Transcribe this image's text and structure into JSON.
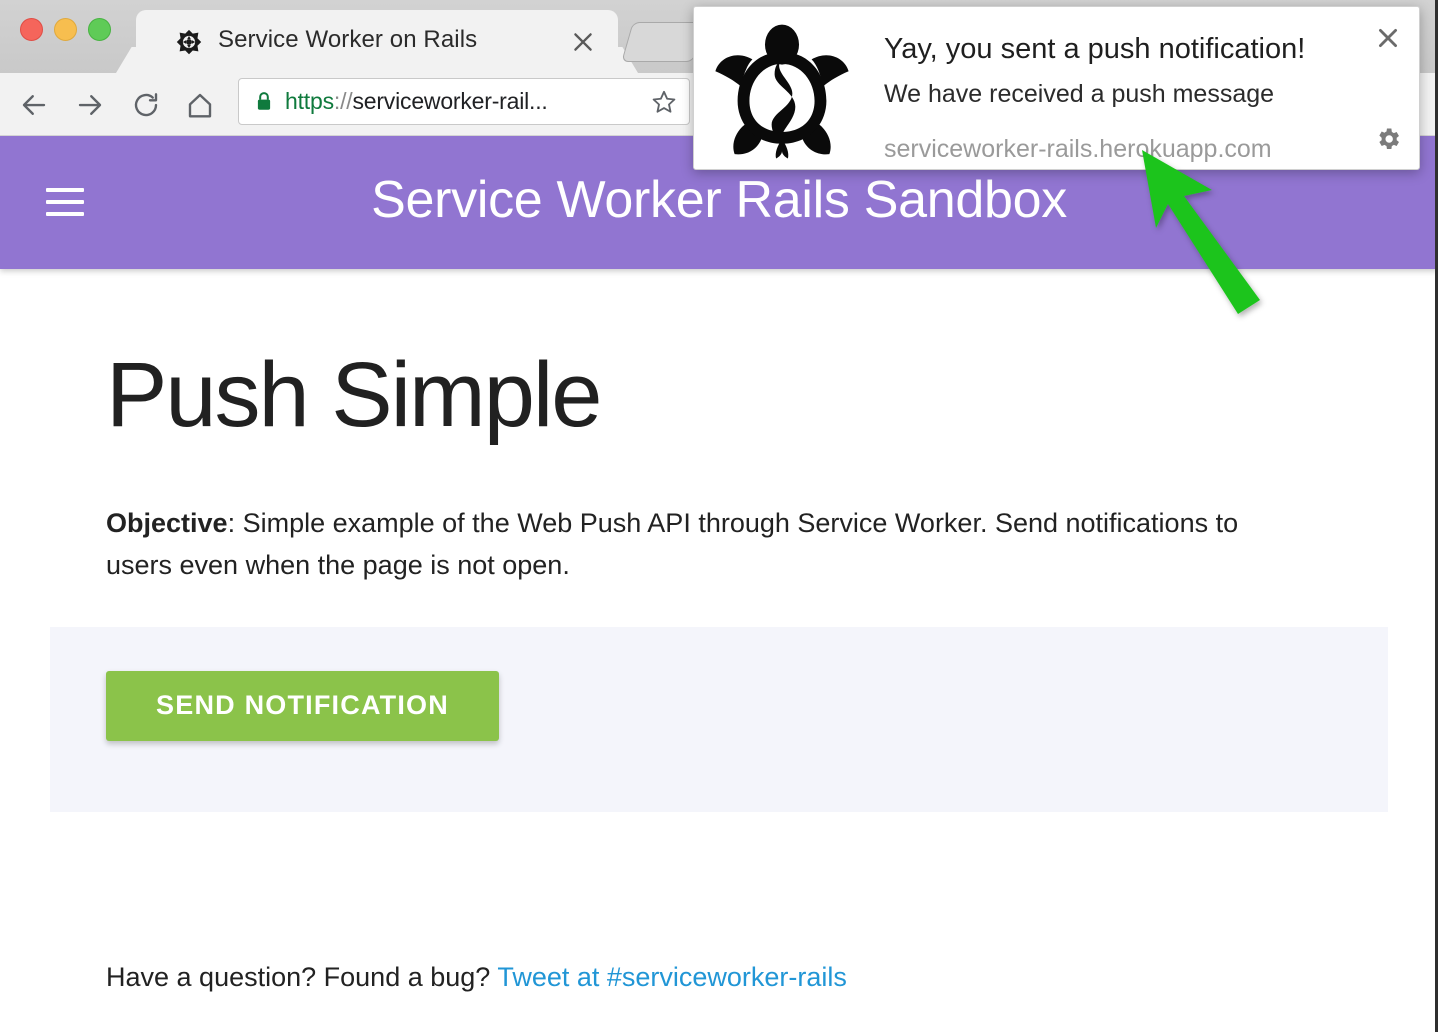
{
  "window": {
    "traffic_lights": [
      "close",
      "minimize",
      "zoom"
    ]
  },
  "browser": {
    "tab": {
      "title": "Service Worker on Rails",
      "favicon": "turtle-favicon",
      "close_label": "✕"
    },
    "new_tab_label": "",
    "nav": {
      "back": "back-arrow",
      "forward": "forward-arrow",
      "reload": "reload-arrow",
      "home": "home-house"
    },
    "omnibox": {
      "scheme": "https",
      "separator": "://",
      "host_truncated": "serviceworker-rail...",
      "full_display": "https://serviceworker-rail...",
      "secure": true,
      "lock_color": "#0f7a3d",
      "bookmark_icon": "star-icon"
    }
  },
  "notification": {
    "title": "Yay, you sent a push notification!",
    "body": "We have received a push message",
    "origin": "serviceworker-rails.herokuapp.com",
    "icon": "turtle-icon",
    "close_label": "✕",
    "settings_icon": "gear-icon"
  },
  "annotation": {
    "arrow": "green-cursor-arrow",
    "color": "#1fc41f",
    "points_at": "serviceworker-rails.herokuapp.com"
  },
  "page": {
    "appbar": {
      "menu_icon": "hamburger-icon",
      "title": "Service Worker Rails Sandbox",
      "background": "#9175d1"
    },
    "heading": "Push Simple",
    "objective": {
      "label": "Objective",
      "separator": ": ",
      "text": "Simple example of the Web Push API through Service Worker. Send notifications to users even when the page is not open."
    },
    "demo": {
      "button_label": "SEND NOTIFICATION",
      "button_color": "#8bc34a",
      "panel_color": "#f4f5fb"
    },
    "footer": {
      "text": "Have a question? Found a bug? ",
      "link_label": "Tweet at #serviceworker-rails",
      "link_color": "#2196d6"
    }
  }
}
